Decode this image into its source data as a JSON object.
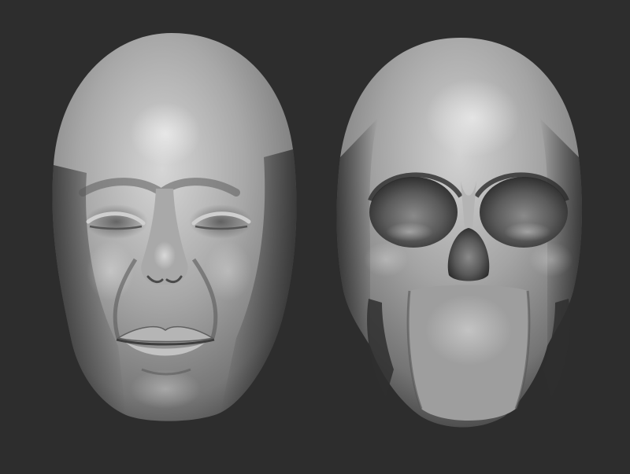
{
  "scene": {
    "background_color": "#2d2d2d",
    "subjects": [
      {
        "name": "sculpted-face",
        "material": "matte-gray-clay"
      },
      {
        "name": "sculpted-skull",
        "material": "matte-gray-clay"
      }
    ]
  },
  "palette": {
    "clay_light": "#d2d2d2",
    "clay_mid": "#9a9a9a",
    "clay_dark": "#4a4a4a",
    "cavity": "#262626"
  }
}
